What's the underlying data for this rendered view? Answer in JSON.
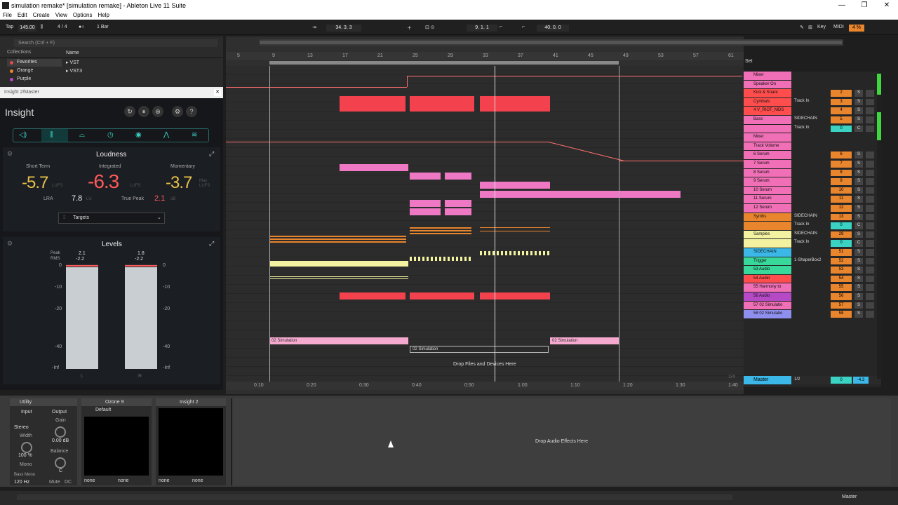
{
  "window": {
    "title": "simulation remake*  [simulation remake] - Ableton Live 11 Suite",
    "minimize": "—",
    "restore": "❐",
    "close": "✕"
  },
  "menu": [
    "File",
    "Edit",
    "Create",
    "View",
    "Options",
    "Help"
  ],
  "transport": {
    "tap": "Tap",
    "tempo": "145.00",
    "signature": "4 / 4",
    "quant": "1 Bar",
    "position": "34.  3.  3",
    "loop_start": "9.  1.  1",
    "loop_len": "40.  0.  0",
    "key": "Key",
    "midi": "MIDI",
    "cpu": "4 %"
  },
  "browser": {
    "search_placeholder": "Search (Ctrl + F)",
    "collections_header": "Collections",
    "name_header": "Name",
    "collections": [
      {
        "label": "Favorites",
        "color": "#e04a4a"
      },
      {
        "label": "Orange",
        "color": "#e9852d"
      },
      {
        "label": "Purple",
        "color": "#b64ac6"
      }
    ],
    "items": [
      "VST",
      "VST3"
    ]
  },
  "insight": {
    "window_title": "Insight 2/Master",
    "title": "Insight",
    "loudness": {
      "header": "Loudness",
      "short_term_label": "Short Term",
      "short_term": "-5.7",
      "integrated_label": "Integrated",
      "integrated": "-6.3",
      "momentary_label": "Momentary",
      "momentary": "-3.7",
      "unit": "LUFS",
      "max_label": "Max",
      "lra_label": "LRA",
      "lra": "7.8",
      "lra_unit": "LU",
      "true_peak_label": "True Peak",
      "true_peak": "2.1",
      "tp_unit": "dB",
      "targets": "Targets"
    },
    "levels": {
      "header": "Levels",
      "peak_label": "Peak",
      "rms_label": "RMS",
      "peak_l": "2.1",
      "peak_r": "1.8",
      "rms_l": "-2.2",
      "rms_r": "-2.2",
      "scale": [
        "0",
        "-10",
        "-20",
        "-40",
        "-Inf"
      ],
      "left": "L",
      "right": "R",
      "level_l": 0.97,
      "level_r": 0.97
    }
  },
  "ruler": {
    "bars": [
      "5",
      "9",
      "13",
      "17",
      "21",
      "25",
      "29",
      "33",
      "37",
      "41",
      "45",
      "49",
      "53",
      "57",
      "61"
    ],
    "times": [
      "0:10",
      "0:20",
      "0:30",
      "0:40",
      "0:50",
      "1:00",
      "1:10",
      "1:20",
      "1:30",
      "1:40"
    ],
    "zoom": "1/4"
  },
  "clips": {
    "sim1": "02 Simulation",
    "sim2": "02 Simulation",
    "sim3": "02 Simulation",
    "drop_files": "Drop Files and Devices Here"
  },
  "mixer": {
    "set_label": "Set",
    "tracks": [
      {
        "name": "Mixer",
        "color": "#f06fb6",
        "num": "",
        "input": ""
      },
      {
        "name": "Speaker On",
        "color": "#f06fb6",
        "num": "",
        "input": ""
      },
      {
        "name": "Kick & Snare",
        "color": "#ff4d4d",
        "num": "2",
        "input": ""
      },
      {
        "name": "Cymbals",
        "color": "#ff4d4d",
        "num": "3",
        "input": "Track In"
      },
      {
        "name": "4 V_RIOT_MDS",
        "color": "#ff4d4d",
        "num": "4",
        "input": ""
      },
      {
        "name": "Bass",
        "color": "#f06fb6",
        "num": "5",
        "input": "SIDECHAIN"
      },
      {
        "name": "",
        "color": "#f06fb6",
        "num": "0",
        "input": "Track In"
      },
      {
        "name": "Mixer",
        "color": "#f06fb6",
        "num": "",
        "input": ""
      },
      {
        "name": "Track Volume",
        "color": "#f06fb6",
        "num": "",
        "input": ""
      },
      {
        "name": "6 Serum",
        "color": "#f06fb6",
        "num": "6",
        "input": ""
      },
      {
        "name": "7 Serum",
        "color": "#f06fb6",
        "num": "7",
        "input": ""
      },
      {
        "name": "8 Serum",
        "color": "#f06fb6",
        "num": "8",
        "input": ""
      },
      {
        "name": "9 Serum",
        "color": "#f06fb6",
        "num": "9",
        "input": ""
      },
      {
        "name": "10 Serum",
        "color": "#f06fb6",
        "num": "10",
        "input": ""
      },
      {
        "name": "11 Serum",
        "color": "#f06fb6",
        "num": "11",
        "input": ""
      },
      {
        "name": "12 Serum",
        "color": "#f06fb6",
        "num": "12",
        "input": ""
      },
      {
        "name": "Synths",
        "color": "#e9852d",
        "num": "13",
        "input": "SIDECHAIN"
      },
      {
        "name": "",
        "color": "#e9852d",
        "num": "0",
        "input": "Track In"
      },
      {
        "name": "Samples",
        "color": "#f2f2a0",
        "num": "29",
        "input": "SIDECHAIN"
      },
      {
        "name": "",
        "color": "#f2f2a0",
        "num": "0",
        "input": "Track In"
      },
      {
        "name": "SIDECHAIN",
        "color": "#3bb8e8",
        "num": "51",
        "input": ""
      },
      {
        "name": "Trigger",
        "color": "#38d89a",
        "num": "52",
        "input": "1-ShaperBox2"
      },
      {
        "name": "53 Audio",
        "color": "#38d89a",
        "num": "53",
        "input": ""
      },
      {
        "name": "54 Audio",
        "color": "#ff4d4d",
        "num": "54",
        "input": ""
      },
      {
        "name": "55 Harmony to",
        "color": "#f06fb6",
        "num": "55",
        "input": ""
      },
      {
        "name": "56 Audio",
        "color": "#b64ac6",
        "num": "56",
        "input": ""
      },
      {
        "name": "57 02 Simulatio",
        "color": "#f06fb6",
        "num": "57",
        "input": ""
      },
      {
        "name": "58 02 Simulatio",
        "color": "#8f8ff0",
        "num": "58",
        "input": ""
      }
    ],
    "master": "Master",
    "master_input": "1/2",
    "master_vol": "0",
    "master_peak": "-4.3",
    "s": "S",
    "c": "C"
  },
  "devices": {
    "utility": {
      "title": "Utility",
      "input": "Input",
      "output": "Output",
      "stereo": "Stereo",
      "width_label": "Width",
      "width": "100 %",
      "mono": "Mono",
      "bass_mono": "Bass Mono",
      "bass_freq": "120 Hz",
      "gain_label": "Gain",
      "gain": "0.00 dB",
      "balance_label": "Balance",
      "balance": "C",
      "mute": "Mute",
      "dc": "DC"
    },
    "ozone": {
      "title": "Ozone 9",
      "preset": "Default",
      "none": "none"
    },
    "insight2": {
      "title": "Insight 2",
      "none": "none"
    },
    "drop_effects": "Drop Audio Effects Here"
  },
  "status": {
    "master": "Master"
  }
}
